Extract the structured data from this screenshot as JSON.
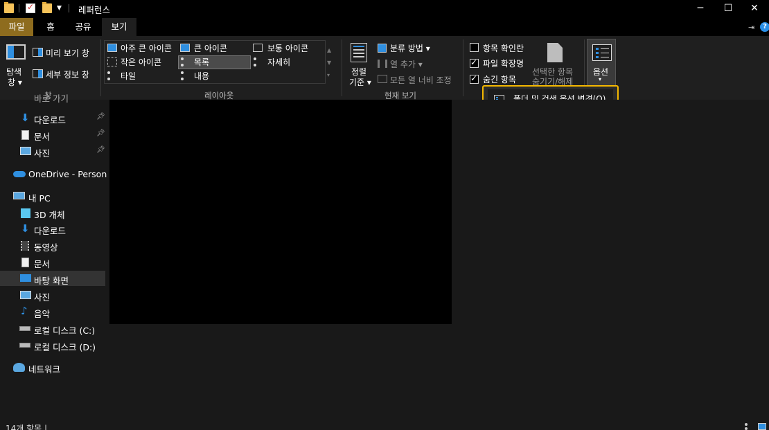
{
  "window": {
    "title": "레퍼런스",
    "minimize": "─",
    "maximize": "☐",
    "close": "✕"
  },
  "tabs": {
    "file": "파일",
    "home": "홈",
    "share": "공유",
    "view": "보기"
  },
  "ribbon": {
    "pane_group": {
      "navigation_pane": "탐색",
      "navigation_pane_2": "창",
      "preview_pane": "미리 보기 창",
      "details_pane": "세부 정보 창",
      "label": "창"
    },
    "layout_group": {
      "extra_large_icons": "아주 큰 아이콘",
      "large_icons": "큰 아이콘",
      "medium_icons": "보통 아이콘",
      "small_icons": "작은 아이콘",
      "list": "목록",
      "details": "자세히",
      "tiles": "타일",
      "content": "내용",
      "label": "레이아웃"
    },
    "current_view_group": {
      "sort_by_1": "정렬",
      "sort_by_2": "기준",
      "group_by": "분류 방법",
      "add_columns": "열 추가",
      "size_all_columns": "모든 열 너비 조정",
      "label": "현재 보기"
    },
    "show_hide_group": {
      "item_check_boxes": "항목 확인란",
      "file_name_extensions": "파일 확장명",
      "hidden_items": "숨긴 항목",
      "hide_selected_1": "선택한 항목",
      "hide_selected_2": "숨기기/해제"
    },
    "options": {
      "label": "옵션",
      "menu_item": "폴더 및 검색 옵션 변경(O)"
    }
  },
  "checkboxes": {
    "item_check_boxes": false,
    "file_name_extensions": true,
    "hidden_items": true
  },
  "nav": {
    "partial_top": "바로 가기",
    "items": [
      {
        "label": "다운로드",
        "icon": "download-icon",
        "pinned": true
      },
      {
        "label": "문서",
        "icon": "document-icon",
        "pinned": true
      },
      {
        "label": "사진",
        "icon": "pictures-icon",
        "pinned": true
      },
      {
        "label": "OneDrive - Personal",
        "icon": "onedrive-icon",
        "pinned": false
      },
      {
        "label": "내 PC",
        "icon": "pc-icon",
        "pinned": false
      },
      {
        "label": "3D 개체",
        "icon": "3d-objects-icon",
        "pinned": false
      },
      {
        "label": "다운로드",
        "icon": "download-icon",
        "pinned": false
      },
      {
        "label": "동영상",
        "icon": "videos-icon",
        "pinned": false
      },
      {
        "label": "문서",
        "icon": "document-icon",
        "pinned": false
      },
      {
        "label": "바탕 화면",
        "icon": "desktop-icon",
        "pinned": false,
        "selected": true
      },
      {
        "label": "사진",
        "icon": "pictures-icon",
        "pinned": false
      },
      {
        "label": "음악",
        "icon": "music-icon",
        "pinned": false
      },
      {
        "label": "로컬 디스크 (C:)",
        "icon": "drive-icon",
        "pinned": false
      },
      {
        "label": "로컬 디스크 (D:)",
        "icon": "drive-icon",
        "pinned": false
      },
      {
        "label": "네트워크",
        "icon": "network-icon",
        "pinned": false
      }
    ]
  },
  "status": {
    "items_count": "14개 항목"
  },
  "colors": {
    "accent_file_tab": "#8e6c1e",
    "highlight_border": "#f5b800",
    "background": "#191919"
  }
}
